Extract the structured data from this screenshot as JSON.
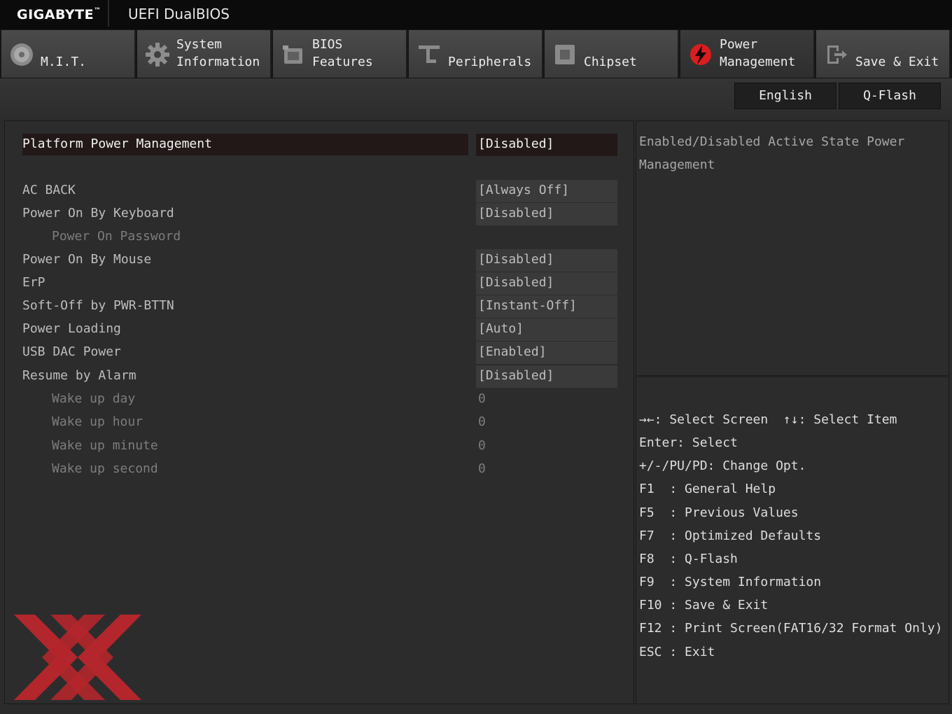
{
  "topbar": {
    "brand": "GIGABYTE",
    "brand_tm": "™",
    "product": "UEFI DualBIOS"
  },
  "tabs": [
    {
      "label": "M.I.T.",
      "icon": "mit-disc-icon"
    },
    {
      "label": "System\nInformation",
      "icon": "gear-icon"
    },
    {
      "label": "BIOS\nFeatures",
      "icon": "bios-chip-icon"
    },
    {
      "label": "Peripherals",
      "icon": "peripherals-icon"
    },
    {
      "label": "Chipset",
      "icon": "chipset-icon"
    },
    {
      "label": "Power\nManagement",
      "icon": "power-bolt-icon",
      "active": true
    },
    {
      "label": "Save & Exit",
      "icon": "exit-door-icon"
    }
  ],
  "toolbar": {
    "language": "English",
    "qflash": "Q-Flash"
  },
  "settings": [
    {
      "label": "Platform Power Management",
      "value": "[Disabled]",
      "selected": true
    },
    {
      "label": "AC BACK",
      "value": "[Always Off]"
    },
    {
      "label": "Power On By Keyboard",
      "value": "[Disabled]"
    },
    {
      "label": "Power On Password",
      "value": ""
    },
    {
      "label": "Power On By Mouse",
      "value": "[Disabled]"
    },
    {
      "label": "ErP",
      "value": "[Disabled]"
    },
    {
      "label": "Soft-Off by PWR-BTTN",
      "value": "[Instant-Off]"
    },
    {
      "label": "Power Loading",
      "value": "[Auto]"
    },
    {
      "label": "USB DAC Power",
      "value": "[Enabled]"
    },
    {
      "label": "Resume by Alarm",
      "value": "[Disabled]"
    },
    {
      "label": "Wake up day",
      "value": "0"
    },
    {
      "label": "Wake up hour",
      "value": "0"
    },
    {
      "label": "Wake up minute",
      "value": "0"
    },
    {
      "label": "Wake up second",
      "value": "0"
    }
  ],
  "help": {
    "text": "Enabled/Disabled Active State Power Management"
  },
  "keys": [
    "→←: Select Screen  ↑↓: Select Item",
    "Enter: Select",
    "+/-/PU/PD: Change Opt.",
    "F1  : General Help",
    "F5  : Previous Values",
    "F7  : Optimized Defaults",
    "F8  : Q-Flash",
    "F9  : System Information",
    "F10 : Save & Exit",
    "F12 : Print Screen(FAT16/32 Format Only)",
    "ESC : Exit"
  ],
  "colors": {
    "accent": "#d81e1e",
    "watermark": "#b3262b",
    "selected_bg": "#221818"
  }
}
